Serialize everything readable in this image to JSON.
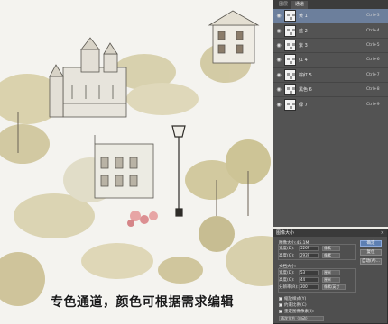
{
  "caption": "专色通道，颜色可根据需求编辑",
  "panel": {
    "tabs": [
      "图层",
      "通道"
    ],
    "channels": [
      {
        "name": "黄 1",
        "shortcut": "Ctrl+3",
        "selected": true
      },
      {
        "name": "蓝 2",
        "shortcut": "Ctrl+4",
        "selected": false
      },
      {
        "name": "紫 3",
        "shortcut": "Ctrl+5",
        "selected": false
      },
      {
        "name": "红 4",
        "shortcut": "Ctrl+6",
        "selected": false
      },
      {
        "name": "棕红 5",
        "shortcut": "Ctrl+7",
        "selected": false
      },
      {
        "name": "黑色 6",
        "shortcut": "Ctrl+8",
        "selected": false
      },
      {
        "name": "绿 7",
        "shortcut": "Ctrl+9",
        "selected": false
      }
    ]
  },
  "dialog": {
    "title": "图像大小",
    "image_size": "图像大小:45.1M",
    "width_label": "宽度(D):",
    "width_value": "5269",
    "height_label": "高度(G):",
    "height_value": "2939",
    "pixel_unit": "像素",
    "doc_size_label": "文档大小:",
    "doc_width_label": "宽度(D):",
    "doc_width_value": "53",
    "doc_height_label": "高度(G):",
    "doc_height_value": "44",
    "resolution_label": "分辨率(R):",
    "resolution_value": "300",
    "cm_unit": "厘米",
    "res_unit": "像素/英寸",
    "ok_label": "确定",
    "cancel_label": "复位",
    "auto_label": "自动(A)...",
    "scale_styles": "缩放样式(Y)",
    "constrain": "约束比例(C)",
    "resample": "重定图像像素(I):",
    "resample_method": "两次立方（自动）",
    "close_glyph": "×"
  }
}
